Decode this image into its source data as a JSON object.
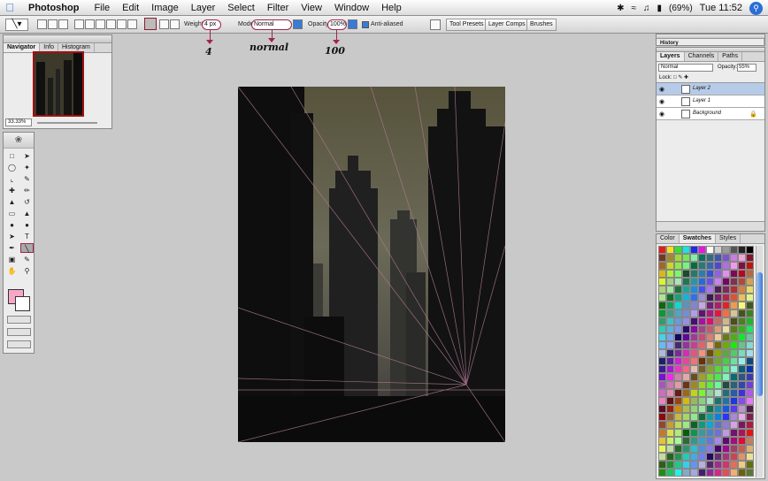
{
  "menubar": {
    "app": "Photoshop",
    "items": [
      "File",
      "Edit",
      "Image",
      "Layer",
      "Select",
      "Filter",
      "View",
      "Window",
      "Help"
    ],
    "battery": "(69%)",
    "time": "Tue 11:52"
  },
  "options": {
    "weight_label": "Weight:",
    "weight_value": "4 px",
    "mode_label": "Mode:",
    "mode_value": "Normal",
    "opacity_label": "Opacity:",
    "opacity_value": "100%",
    "antialias_label": "Anti-aliased",
    "tool_presets": "Tool Presets",
    "layer_comps": "Layer Comps",
    "brushes": "Brushes"
  },
  "annotations": {
    "weight": "4",
    "mode": "normal",
    "opacity": "100"
  },
  "navigator": {
    "tabs": [
      "Navigator",
      "Info",
      "Histogram"
    ],
    "zoom": "33.33%"
  },
  "history": {
    "tab": "History"
  },
  "layers": {
    "tabs": [
      "Layers",
      "Channels",
      "Paths"
    ],
    "blend_mode": "Normal",
    "opacity_label": "Opacity:",
    "opacity_value": "55%",
    "lock_label": "Lock:",
    "items": [
      {
        "name": "Layer 2",
        "active": true
      },
      {
        "name": "Layer 1",
        "active": false
      },
      {
        "name": "Background",
        "active": false
      }
    ]
  },
  "swatches_panel": {
    "tabs": [
      "Color",
      "Swatches",
      "Styles"
    ]
  },
  "colors": {
    "foreground": "#f7a6c8",
    "background": "#ffffff",
    "annotation": "#a3244b"
  }
}
